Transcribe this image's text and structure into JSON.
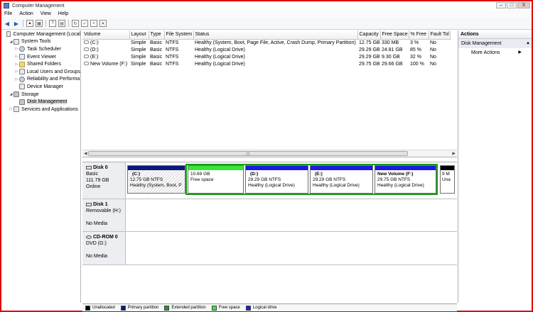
{
  "window": {
    "title": "Computer Management",
    "minimize": "–",
    "maximize": "□",
    "close": "X"
  },
  "menu": [
    "File",
    "Action",
    "View",
    "Help"
  ],
  "tree": [
    {
      "label": "Computer Management (Local",
      "indent": 0,
      "exp": "",
      "icon": "computer-icon",
      "selected": false
    },
    {
      "label": "System Tools",
      "indent": 1,
      "exp": "◢",
      "icon": "tools-icon",
      "selected": false
    },
    {
      "label": "Task Scheduler",
      "indent": 2,
      "exp": "▷",
      "icon": "clock-icon",
      "selected": false
    },
    {
      "label": "Event Viewer",
      "indent": 2,
      "exp": "▷",
      "icon": "event-icon",
      "selected": false
    },
    {
      "label": "Shared Folders",
      "indent": 2,
      "exp": "▷",
      "icon": "folder-icon",
      "selected": false
    },
    {
      "label": "Local Users and Groups",
      "indent": 2,
      "exp": "▷",
      "icon": "users-icon",
      "selected": false
    },
    {
      "label": "Reliability and Performa",
      "indent": 2,
      "exp": "▷",
      "icon": "gear-icon",
      "selected": false
    },
    {
      "label": "Device Manager",
      "indent": 2,
      "exp": "",
      "icon": "device-icon",
      "selected": false
    },
    {
      "label": "Storage",
      "indent": 1,
      "exp": "◢",
      "icon": "storage-icon",
      "selected": false
    },
    {
      "label": "Disk Management",
      "indent": 2,
      "exp": "",
      "icon": "disk-icon",
      "selected": true
    },
    {
      "label": "Services and Applications",
      "indent": 1,
      "exp": "▷",
      "icon": "services-icon",
      "selected": false
    }
  ],
  "volume_table": {
    "columns": [
      "Volume",
      "Layout",
      "Type",
      "File System",
      "Status",
      "Capacity",
      "Free Space",
      "% Free",
      "Fault Tol"
    ],
    "rows": [
      [
        "(C:)",
        "Simple",
        "Basic",
        "NTFS",
        "Healthy (System, Boot, Page File, Active, Crash Dump, Primary Partition)",
        "12.75 GB",
        "330 MB",
        "3 %",
        "No"
      ],
      [
        "(D:)",
        "Simple",
        "Basic",
        "NTFS",
        "Healthy (Logical Drive)",
        "29.29 GB",
        "24.81 GB",
        "85 %",
        "No"
      ],
      [
        "(E:)",
        "Simple",
        "Basic",
        "NTFS",
        "Healthy (Logical Drive)",
        "29.29 GB",
        "9.30 GB",
        "32 %",
        "No"
      ],
      [
        "New Volume (F:)",
        "Simple",
        "Basic",
        "NTFS",
        "Healthy (Logical Drive)",
        "29.75 GB",
        "29.66 GB",
        "100 %",
        "No"
      ]
    ]
  },
  "disks": [
    {
      "name": "Disk 0",
      "lines": [
        "Basic",
        "111.79 GB",
        "Online"
      ],
      "partitions": [
        {
          "name": "(C:)",
          "size": "12.75 GB NTFS",
          "status": "Healthy (System, Boot, P",
          "bar": "#0a1a7a",
          "hatched": true
        },
        {
          "name": "",
          "size": "10.69 GB",
          "status": "Free space",
          "bar": "#39e539",
          "hatched": false
        },
        {
          "name": "(D:)",
          "size": "29.29 GB NTFS",
          "status": "Healthy (Logical Drive)",
          "bar": "#1a1ae0",
          "hatched": false
        },
        {
          "name": "(E:)",
          "size": "29.29 GB NTFS",
          "status": "Healthy (Logical Drive)",
          "bar": "#1a1ae0",
          "hatched": false
        },
        {
          "name": "New Volume  (F:)",
          "size": "29.75 GB NTFS",
          "status": "Healthy (Logical Drive)",
          "bar": "#1a1ae0",
          "hatched": false
        },
        {
          "name": "",
          "size": "9 M",
          "status": "Una",
          "bar": "#000000",
          "hatched": false
        }
      ]
    },
    {
      "name": "Disk 1",
      "lines": [
        "Removable (H:)",
        "",
        "No Media"
      ]
    },
    {
      "name": "CD-ROM 0",
      "lines": [
        "DVD (G:)",
        "",
        "No Media"
      ]
    }
  ],
  "actions": {
    "header": "Actions",
    "section": "Disk Management",
    "item": "More Actions"
  },
  "legend": [
    {
      "label": "Unallocated",
      "color": "#000000"
    },
    {
      "label": "Primary partition",
      "color": "#0a1a7a"
    },
    {
      "label": "Extended partition",
      "color": "#1a9a1a"
    },
    {
      "label": "Free space",
      "color": "#39e539"
    },
    {
      "label": "Logical drive",
      "color": "#1a1ae0"
    }
  ]
}
